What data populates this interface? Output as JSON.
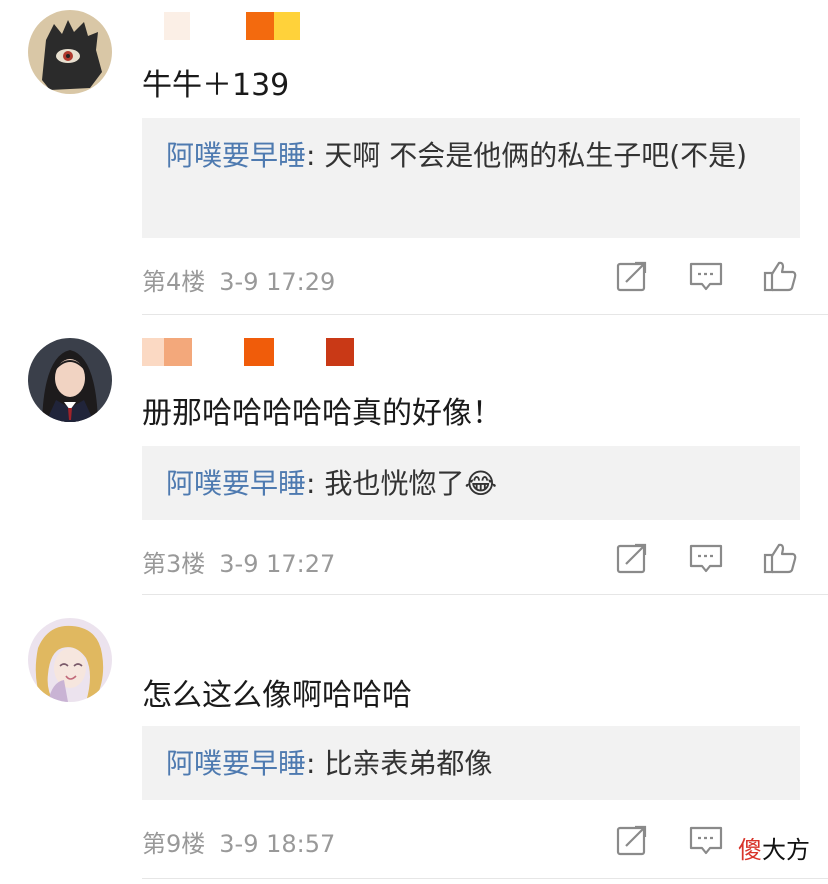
{
  "comments": [
    {
      "name_block_colors": [
        "#fbefe6",
        "#f36a0e",
        "#ffd23a"
      ],
      "text": "牛牛＋139",
      "reply_user": "阿噗要早睡",
      "reply_sep": ": ",
      "reply_text": "天啊 不会是他俩的私生子吧(不是)",
      "floor": "第4楼",
      "time": "3-9 17:29"
    },
    {
      "name_block_colors": [
        "#fbd9c3",
        "#f3a87b",
        "#f05c0a",
        "#c93916"
      ],
      "text": "册那哈哈哈哈哈真的好像！",
      "reply_user": "阿噗要早睡",
      "reply_sep": ": ",
      "reply_text": "我也恍惚了😂",
      "floor": "第3楼",
      "time": "3-9 17:27"
    },
    {
      "name_block_colors": [],
      "text": "怎么这么像啊哈哈哈",
      "reply_user": "阿噗要早睡",
      "reply_sep": ": ",
      "reply_text": "比亲表弟都像",
      "floor": "第9楼",
      "time": "3-9 18:57"
    }
  ],
  "icons": {
    "share": "share-icon",
    "reply": "comment-icon",
    "like": "thumbs-up-icon"
  },
  "watermark": {
    "red": "傻",
    "black": "大方"
  }
}
